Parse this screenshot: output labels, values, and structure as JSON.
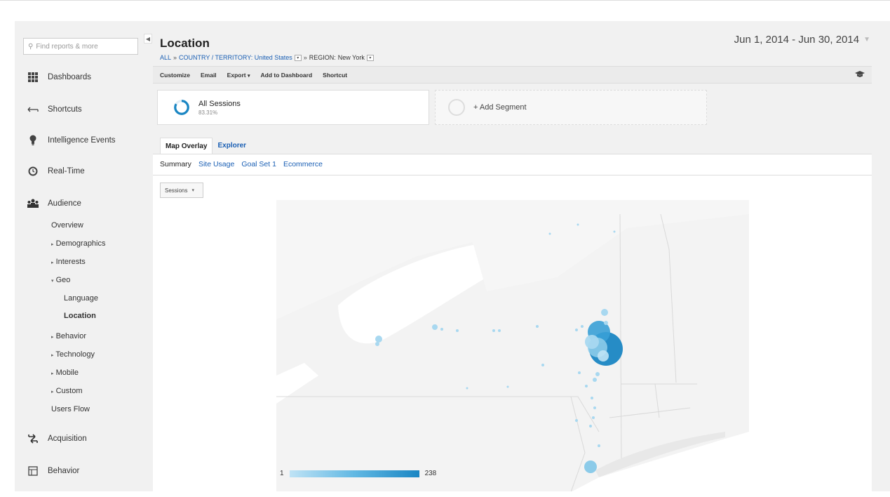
{
  "sidebar": {
    "search_placeholder": "Find reports & more",
    "nav": [
      {
        "label": "Dashboards",
        "icon": "grid-icon"
      },
      {
        "label": "Shortcuts",
        "icon": "shortcut-arrow-icon"
      },
      {
        "label": "Intelligence Events",
        "icon": "lightbulb-icon"
      },
      {
        "label": "Real-Time",
        "icon": "clock-icon"
      },
      {
        "label": "Audience",
        "icon": "people-icon"
      },
      {
        "label": "Acquisition",
        "icon": "arrows-icon"
      },
      {
        "label": "Behavior",
        "icon": "window-icon"
      }
    ],
    "audience_items": {
      "overview": "Overview",
      "demographics": "Demographics",
      "interests": "Interests",
      "geo": "Geo",
      "language": "Language",
      "location": "Location",
      "behavior": "Behavior",
      "technology": "Technology",
      "mobile": "Mobile",
      "custom": "Custom",
      "users_flow": "Users Flow"
    }
  },
  "header": {
    "title": "Location",
    "breadcrumb": {
      "all": "ALL",
      "country": "COUNTRY / TERRITORY: United States",
      "region_label": "REGION:",
      "region_value": "New York"
    },
    "date_range": "Jun 1, 2014 - Jun 30, 2014"
  },
  "toolbar": {
    "customize": "Customize",
    "email": "Email",
    "export": "Export",
    "add_to_dashboard": "Add to Dashboard",
    "shortcut": "Shortcut"
  },
  "segments": {
    "all_sessions": "All Sessions",
    "all_sessions_pct": "83.31%",
    "add_segment": "+ Add Segment"
  },
  "tabs": {
    "map_overlay": "Map Overlay",
    "explorer": "Explorer"
  },
  "subtabs": {
    "summary": "Summary",
    "site_usage": "Site Usage",
    "goal_set": "Goal Set 1",
    "ecommerce": "Ecommerce"
  },
  "metric_select": "Sessions",
  "legend": {
    "min": "1",
    "max": "238"
  },
  "colors": {
    "link": "#1a5fb4",
    "accent": "#4d90fe",
    "bubble_light": "#a8d8f0",
    "bubble_dark": "#1a86c3"
  }
}
